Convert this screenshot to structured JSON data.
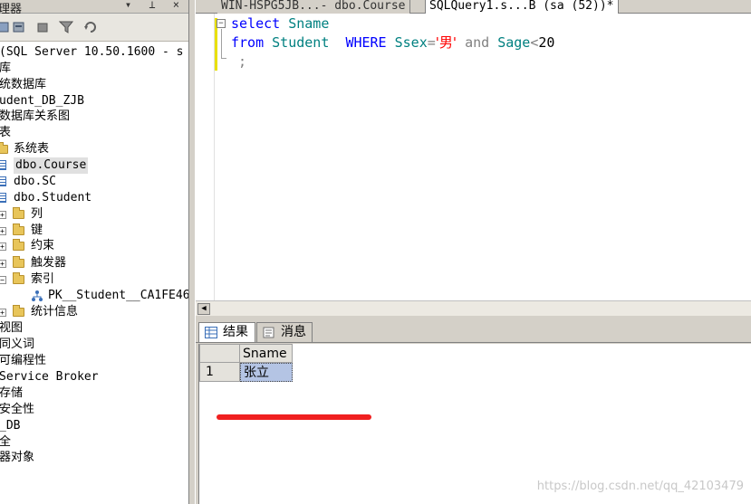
{
  "explorer": {
    "title_fragment": "理器",
    "title_buttons": "▾ ⊥ ×",
    "tree": [
      {
        "label": "(SQL Server 10.50.1600 - s",
        "cjk": false
      },
      {
        "label": "库",
        "cjk": true
      },
      {
        "label": "统数据库",
        "cjk": true
      },
      {
        "label": "udent_DB_ZJB",
        "cjk": false
      },
      {
        "label": "数据库关系图",
        "cjk": true
      },
      {
        "label": "表",
        "cjk": true
      },
      {
        "label": "系统表",
        "cjk": true,
        "icon": "folder"
      },
      {
        "label": "dbo.Course",
        "cjk": false,
        "icon": "table",
        "selected": true
      },
      {
        "label": "dbo.SC",
        "cjk": false,
        "icon": "table"
      },
      {
        "label": "dbo.Student",
        "cjk": false,
        "icon": "table"
      },
      {
        "label": "列",
        "cjk": true,
        "icon": "folder",
        "expander": "+"
      },
      {
        "label": "键",
        "cjk": true,
        "icon": "folder",
        "expander": "+"
      },
      {
        "label": "约束",
        "cjk": true,
        "icon": "folder",
        "expander": "+"
      },
      {
        "label": "触发器",
        "cjk": true,
        "icon": "folder",
        "expander": "+"
      },
      {
        "label": "索引",
        "cjk": true,
        "icon": "folder",
        "expander": "−"
      },
      {
        "label": "PK__Student__CA1FE46",
        "cjk": false,
        "icon": "index"
      },
      {
        "label": "统计信息",
        "cjk": true,
        "icon": "folder",
        "expander": "+"
      },
      {
        "label": "视图",
        "cjk": true
      },
      {
        "label": "同义词",
        "cjk": true
      },
      {
        "label": "可编程性",
        "cjk": true
      },
      {
        "label": "Service Broker",
        "cjk": false
      },
      {
        "label": "存储",
        "cjk": true
      },
      {
        "label": "安全性",
        "cjk": true
      },
      {
        "label": "_DB",
        "cjk": false
      },
      {
        "label": "全",
        "cjk": true
      },
      {
        "label": "器对象",
        "cjk": true
      }
    ]
  },
  "tabs": [
    {
      "label": "WIN-HSPG5JB...- dbo.Course",
      "active": false
    },
    {
      "label": "SQLQuery1.s...B (sa (52))*",
      "active": true
    }
  ],
  "editor": {
    "line1": {
      "kw": "select",
      "id": "Sname"
    },
    "line2": {
      "kw1": "from",
      "id1": "Student",
      "kw2": "WHERE",
      "id2": "Ssex",
      "eq": "=",
      "str": "'男'",
      "and": "and",
      "id3": "Sage",
      "lt": "<",
      "num": "20"
    },
    "line3": {
      "text": ";"
    }
  },
  "results": {
    "tab_results": "结果",
    "tab_messages": "消息",
    "columns": [
      "Sname"
    ],
    "rows": [
      {
        "num": "1",
        "cells": [
          "张立"
        ]
      }
    ]
  },
  "watermark": "https://blog.csdn.net/qq_42103479",
  "colors": {
    "keyword": "#0000ff",
    "identifier": "#008080",
    "string": "#ff0000",
    "operator": "#808080",
    "annotation": "#f02020"
  }
}
